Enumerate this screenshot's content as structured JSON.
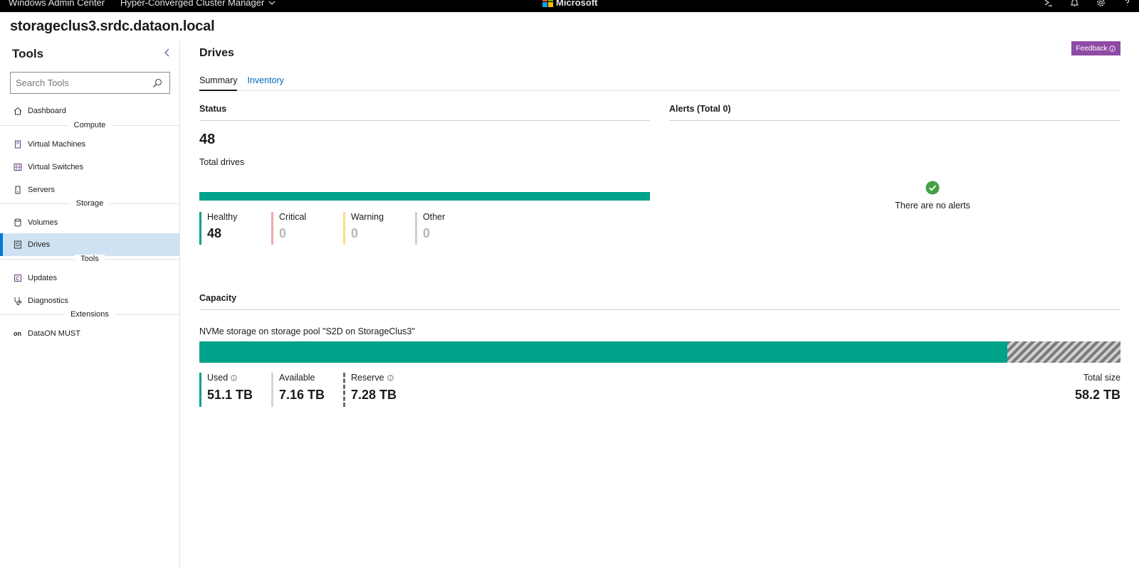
{
  "topbar": {
    "app_title": "Windows Admin Center",
    "solution": "Hyper-Converged Cluster Manager",
    "brand": "Microsoft",
    "icons": [
      "powershell-icon",
      "bell-icon",
      "gear-icon",
      "help-icon"
    ]
  },
  "connection": "storageclus3.srdc.dataon.local",
  "sidebar": {
    "title": "Tools",
    "search_placeholder": "Search Tools",
    "items": [
      {
        "label": "Dashboard",
        "icon": "home-icon"
      },
      {
        "group": "Compute"
      },
      {
        "label": "Virtual Machines",
        "icon": "vm-icon"
      },
      {
        "label": "Virtual Switches",
        "icon": "switch-icon"
      },
      {
        "label": "Servers",
        "icon": "server-icon"
      },
      {
        "group": "Storage"
      },
      {
        "label": "Volumes",
        "icon": "volume-icon"
      },
      {
        "label": "Drives",
        "icon": "drive-icon",
        "active": true
      },
      {
        "group": "Tools"
      },
      {
        "label": "Updates",
        "icon": "updates-icon"
      },
      {
        "label": "Diagnostics",
        "icon": "stethoscope-icon"
      },
      {
        "group": "Extensions"
      },
      {
        "label": "DataON MUST",
        "icon": "on-glyph",
        "glyph": "on"
      }
    ]
  },
  "main": {
    "title": "Drives",
    "feedback_label": "Feedback",
    "tabs": [
      {
        "label": "Summary",
        "selected": true
      },
      {
        "label": "Inventory",
        "selected": false
      }
    ],
    "status": {
      "title": "Status",
      "total": "48",
      "total_label": "Total drives",
      "healthy_fraction": 1.0,
      "breakdown": [
        {
          "label": "Healthy",
          "value": "48",
          "color": "#00a28a"
        },
        {
          "label": "Critical",
          "value": "0",
          "color": "#f2a8a8"
        },
        {
          "label": "Warning",
          "value": "0",
          "color": "#f7de8a"
        },
        {
          "label": "Other",
          "value": "0",
          "color": "#cfcfcf"
        }
      ]
    },
    "alerts": {
      "title": "Alerts (Total 0)",
      "empty_message": "There are no alerts"
    },
    "capacity": {
      "title": "Capacity",
      "pool_label": "NVMe storage on storage pool \"S2D on StorageClus3\"",
      "used_fraction": 0.877,
      "reserve_fraction": 0.123,
      "used_label": "Used",
      "used_value": "51.1 TB",
      "available_label": "Available",
      "available_value": "7.16 TB",
      "reserve_label": "Reserve",
      "reserve_value": "7.28 TB",
      "total_label": "Total size",
      "total_value": "58.2 TB"
    }
  },
  "colors": {
    "accent": "#00a28a",
    "link": "#0067b8",
    "active_nav": "#cfe2f3",
    "feedback": "#8f4aa4",
    "ok_green": "#43a047"
  }
}
